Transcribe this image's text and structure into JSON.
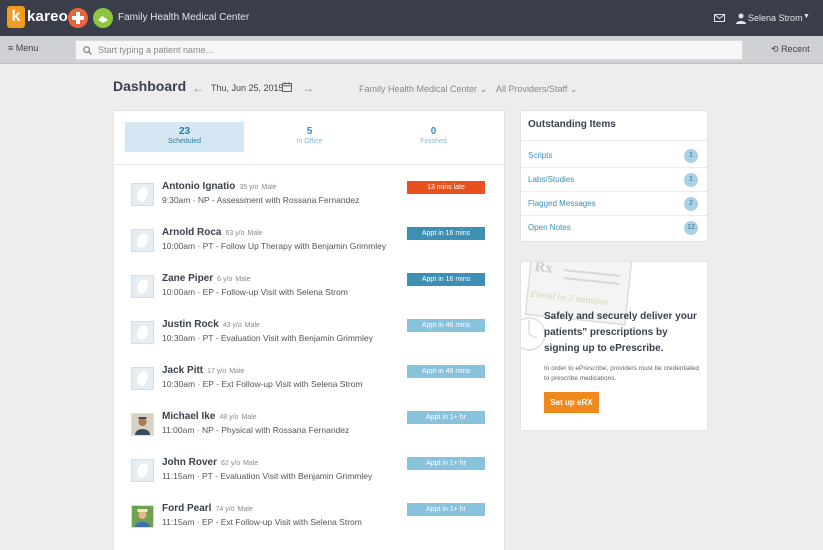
{
  "app": {
    "logo_text": "kareo",
    "practice_name": "Family Health Medical Center",
    "user_name": "Selena Strom",
    "icons": [
      "mail-icon",
      "user-icon",
      "caret-down-icon"
    ]
  },
  "subbar": {
    "menu_label": "Menu",
    "search_placeholder": "Start typing a patient name...",
    "recent_label": "Recent"
  },
  "dashboard": {
    "title": "Dashboard",
    "date": "Thu, Jun 25, 2015",
    "facility": "Family Health Medical Center",
    "providers": "All Providers/Staff"
  },
  "tabs": [
    {
      "count": "23",
      "label": "Scheduled",
      "active": true
    },
    {
      "count": "5",
      "label": "In Office",
      "active": false
    },
    {
      "count": "0",
      "label": "Finished",
      "active": false
    }
  ],
  "appointments": [
    {
      "name": "Antonio Ignatio",
      "age": "35 y/o",
      "sex": "Male",
      "appt": "9:30am · NP - Assessment with Rossana Fernandez",
      "status": "13 mins late",
      "status_color": "#e8501e",
      "photo": false
    },
    {
      "name": "Arnold Roca",
      "age": "63 y/o",
      "sex": "Male",
      "appt": "10:00am · PT - Follow Up Therapy with Benjamin Grimmley",
      "status": "Appt in 16 mins",
      "status_color": "#3d8fb3",
      "photo": false
    },
    {
      "name": "Zane Piper",
      "age": "6 y/o",
      "sex": "Male",
      "appt": "10:00am · EP - Follow-up Visit with Selena Strom",
      "status": "Appt in 16 mins",
      "status_color": "#3d8fb3",
      "photo": false
    },
    {
      "name": "Justin Rock",
      "age": "43 y/o",
      "sex": "Male",
      "appt": "10:30am · PT - Evaluation Visit with Benjamin Grimmley",
      "status": "Appt in 46 mins",
      "status_color": "#89c2dc",
      "photo": false
    },
    {
      "name": "Jack Pitt",
      "age": "17 y/o",
      "sex": "Male",
      "appt": "10:30am · EP - Ext Follow-up Visit with Selena Strom",
      "status": "Appt in 46 mins",
      "status_color": "#89c2dc",
      "photo": false
    },
    {
      "name": "Michael Ike",
      "age": "48 y/o",
      "sex": "Male",
      "appt": "11:00am · NP - Physical with Rossana Fernandez",
      "status": "Appt in 1+ hr",
      "status_color": "#89c2dc",
      "photo": true
    },
    {
      "name": "John Rover",
      "age": "62 y/o",
      "sex": "Male",
      "appt": "11:15am · PT - Evaluation Visit with Benjamin Grimmley",
      "status": "Appt in 1+ hr",
      "status_color": "#89c2dc",
      "photo": false
    },
    {
      "name": "Ford Pearl",
      "age": "74 y/o",
      "sex": "Male",
      "appt": "11:15am · EP - Ext Follow-up Visit with Selena Strom",
      "status": "Appt in 1+ hr",
      "status_color": "#89c2dc",
      "photo": true
    }
  ],
  "outstanding": {
    "title": "Outstanding Items",
    "items": [
      {
        "label": "Scripts",
        "count": "1"
      },
      {
        "label": "Labs/Studies",
        "count": "1"
      },
      {
        "label": "Flagged Messages",
        "count": "2"
      },
      {
        "label": "Open Notes",
        "count": "12"
      }
    ]
  },
  "promo": {
    "heading": "Safely and securely deliver your patients\" prescriptions by signing up to ePrescribe.",
    "body": "In order to ePrescribe, providers must be credentialed to prescribe medications.",
    "button_label": "Set up eRX",
    "art_rx": "Rx",
    "art_script": "Enroll in 3 minutes"
  },
  "colors": {
    "topbar": "#3a3d4a",
    "accent_blue": "#3a8fb7",
    "late": "#e8501e",
    "cta_orange": "#f0891c"
  }
}
